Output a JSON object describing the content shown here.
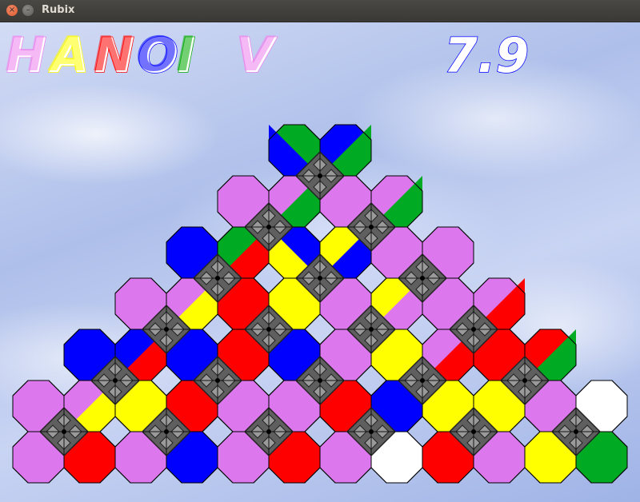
{
  "window": {
    "title": "Rubix"
  },
  "header": {
    "title_letters": [
      {
        "char": "H",
        "color": "#ee82ee"
      },
      {
        "char": "A",
        "color": "#ffff00"
      },
      {
        "char": "N",
        "color": "#ff0000"
      },
      {
        "char": "O",
        "color": "#0000ff"
      },
      {
        "char": "I",
        "color": "#00aa00"
      },
      {
        "char": " ",
        "color": "#ffffff"
      },
      {
        "char": "V",
        "color": "#ee82ee"
      }
    ],
    "version": "7.9",
    "version_color": "#0000ff"
  },
  "colors": {
    "P": "#dd77ee",
    "Y": "#ffff00",
    "R": "#ff0000",
    "B": "#0000ff",
    "G": "#00aa22",
    "W": "#ffffff",
    "hub": "#5f5f5f",
    "hub_light": "#9a9a9a"
  },
  "board": {
    "rows": [
      [
        [
          "G",
          "B",
          "Y",
          "P"
        ]
      ],
      [
        [
          "P",
          "P",
          "P",
          "G"
        ],
        [
          "P",
          "P",
          "G",
          "G"
        ]
      ],
      [
        [
          "B",
          "G",
          "P",
          "R"
        ],
        [
          "B",
          "Y",
          "P",
          "P"
        ],
        [
          "P",
          "P",
          "B",
          "B"
        ]
      ],
      [
        [
          "P",
          "P",
          "Y",
          "Y"
        ],
        [
          "R",
          "Y",
          "Y",
          "P"
        ],
        [
          "P",
          "Y",
          "Y",
          "R"
        ],
        [
          "P",
          "P",
          "P",
          "P"
        ]
      ],
      [
        [
          "B",
          "B",
          "Y",
          "R"
        ],
        [
          "B",
          "R",
          "R",
          "Y"
        ],
        [
          "B",
          "P",
          "G",
          "G"
        ],
        [
          "Y",
          "P",
          "W",
          "G"
        ],
        [
          "R",
          "R",
          "R",
          "R"
        ]
      ],
      [
        [
          "P",
          "P",
          "P",
          "R"
        ],
        [
          "Y",
          "R",
          "P",
          "B"
        ],
        [
          "P",
          "P",
          "P",
          "R"
        ],
        [
          "R",
          "B",
          "P",
          "W"
        ],
        [
          "Y",
          "Y",
          "R",
          "P"
        ],
        [
          "P",
          "W",
          "Y",
          "G"
        ]
      ]
    ],
    "hub_tiles": [
      [
        [
          "B",
          "G",
          "Y",
          "P"
        ]
      ],
      [
        [
          "P",
          "G",
          "P",
          "G"
        ],
        [
          "P",
          "G",
          "P",
          "G"
        ]
      ],
      [
        [
          "B",
          "R",
          "P",
          "P"
        ],
        [
          "Y",
          "B",
          "P",
          "R"
        ],
        [
          "P",
          "P",
          "B",
          "R"
        ]
      ],
      [
        [
          "P",
          "Y",
          "Y",
          "R"
        ],
        [
          "R",
          "Y",
          "Y",
          "P"
        ],
        [
          "P",
          "P",
          "Y",
          "R"
        ],
        [
          "P",
          "R",
          "P",
          "P"
        ]
      ],
      [
        [
          "B",
          "R",
          "Y",
          "R"
        ],
        [
          "B",
          "R",
          "R",
          "Y"
        ],
        [
          "B",
          "P",
          "G",
          "R"
        ],
        [
          "Y",
          "R",
          "W",
          "G"
        ],
        [
          "R",
          "G",
          "R",
          "W"
        ]
      ],
      [
        [
          "P",
          "Y",
          "P",
          "R"
        ],
        [
          "Y",
          "R",
          "P",
          "B"
        ],
        [
          "P",
          "P",
          "P",
          "R"
        ],
        [
          "R",
          "B",
          "P",
          "W"
        ],
        [
          "Y",
          "Y",
          "R",
          "P"
        ],
        [
          "P",
          "W",
          "Y",
          "G"
        ]
      ]
    ]
  }
}
